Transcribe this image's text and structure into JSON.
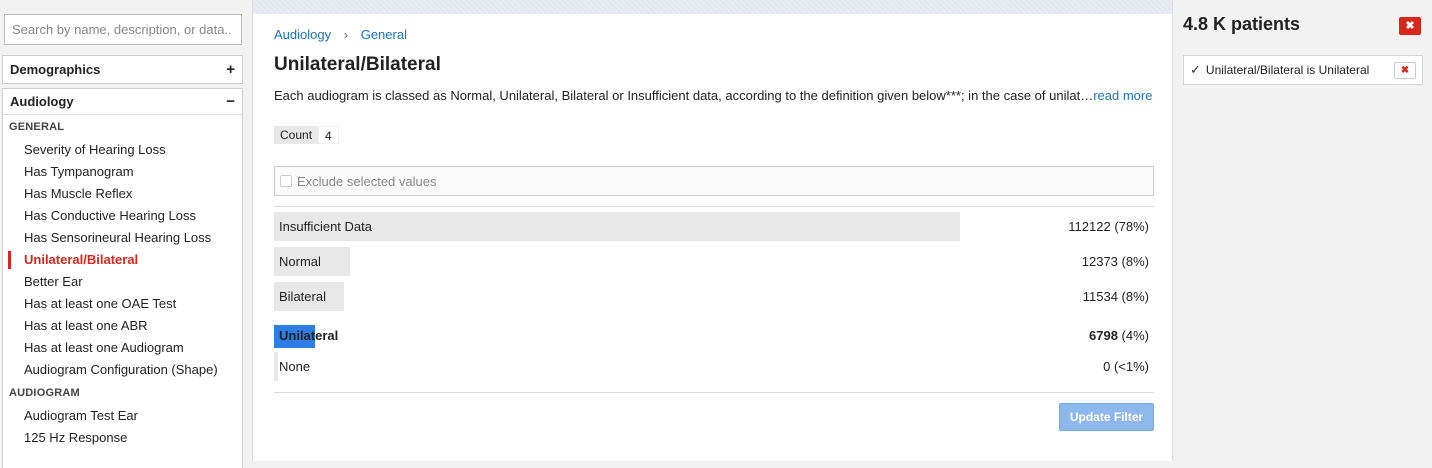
{
  "sidebar": {
    "search_placeholder": "Search by name, description, or data..",
    "sections": [
      {
        "label": "Demographics",
        "toggle": "+"
      },
      {
        "label": "Audiology",
        "toggle": "−"
      }
    ],
    "groups": [
      {
        "label": "GENERAL",
        "items": [
          "Severity of Hearing Loss",
          "Has Tympanogram",
          "Has Muscle Reflex",
          "Has Conductive Hearing Loss",
          "Has Sensorineural Hearing Loss",
          "Unilateral/Bilateral",
          "Better Ear",
          "Has at least one OAE Test",
          "Has at least one ABR",
          "Has at least one Audiogram",
          "Audiogram Configuration (Shape)"
        ]
      },
      {
        "label": "AUDIOGRAM",
        "items": [
          "Audiogram Test Ear",
          "125 Hz Response"
        ]
      }
    ],
    "active_item": "Unilateral/Bilateral"
  },
  "main": {
    "breadcrumb": [
      "Audiology",
      "General"
    ],
    "breadcrumb_sep": "›",
    "title": "Unilateral/Bilateral",
    "description": "Each audiogram is classed as Normal, Unilateral, Bilateral or Insufficient data, according to the definition given below***; in the case of unilat…",
    "read_more": "read more",
    "count_label": "Count",
    "count_value": "4",
    "exclude_label": "Exclude selected values",
    "rows": [
      {
        "label": "Insufficient Data",
        "num": "112122",
        "pct": "(78%)",
        "share": 0.78
      },
      {
        "label": "Normal",
        "num": "12373",
        "pct": "(8%)",
        "share": 0.086
      },
      {
        "label": "Bilateral",
        "num": "11534",
        "pct": "(8%)",
        "share": 0.08
      },
      {
        "label": "Unilateral",
        "num": "6798",
        "pct": "(4%)",
        "share": 0.047,
        "selected": true
      },
      {
        "label": "None",
        "num": "0",
        "pct": "(<1%)",
        "share": 0.004
      }
    ],
    "update_button": "Update Filter"
  },
  "right": {
    "patients": "4.8 K patients",
    "close_glyph": "✖",
    "filters": [
      {
        "check": "✓",
        "text": "Unilateral/Bilateral is Unilateral"
      }
    ]
  },
  "colors": {
    "accent_red": "#d9261c",
    "link_blue": "#1a73c0",
    "selected_bar": "#2e7de6",
    "bar_gray": "#e8e8e8"
  }
}
